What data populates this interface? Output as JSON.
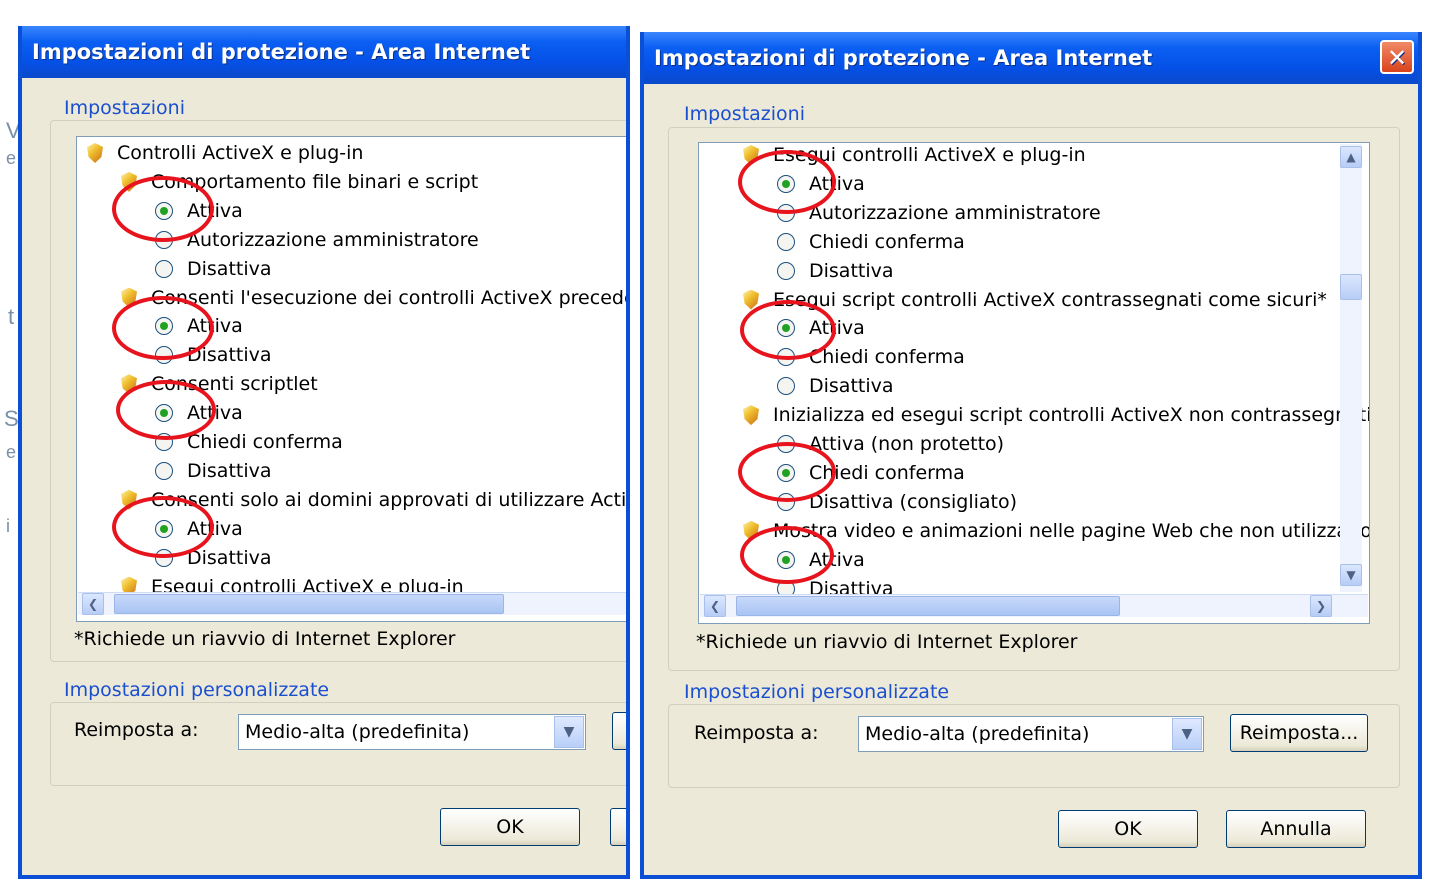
{
  "left_dialog": {
    "title": "Impostazioni di protezione - Area Internet",
    "settings_legend": "Impostazioni",
    "tree": [
      {
        "kind": "icon",
        "text": "Controlli ActiveX e plug-in"
      },
      {
        "kind": "icon",
        "text": "Comportamento file binari e script"
      },
      {
        "kind": "radio",
        "checked": true,
        "text": "Attiva"
      },
      {
        "kind": "radio",
        "checked": false,
        "text": "Autorizzazione amministratore"
      },
      {
        "kind": "radio",
        "checked": false,
        "text": "Disattiva"
      },
      {
        "kind": "icon",
        "text": "Consenti l'esecuzione dei controlli ActiveX precedentem"
      },
      {
        "kind": "radio",
        "checked": true,
        "text": "Attiva"
      },
      {
        "kind": "radio",
        "checked": false,
        "text": "Disattiva"
      },
      {
        "kind": "icon",
        "text": "Consenti scriptlet"
      },
      {
        "kind": "radio",
        "checked": true,
        "text": "Attiva"
      },
      {
        "kind": "radio",
        "checked": false,
        "text": "Chiedi conferma"
      },
      {
        "kind": "radio",
        "checked": false,
        "text": "Disattiva"
      },
      {
        "kind": "icon",
        "text": "Consenti solo ai domini approvati di utilizzare ActiveX se"
      },
      {
        "kind": "radio",
        "checked": true,
        "text": "Attiva"
      },
      {
        "kind": "radio",
        "checked": false,
        "text": "Disattiva"
      },
      {
        "kind": "icon",
        "text": "Esegui controlli ActiveX e plug-in"
      }
    ],
    "restart_note": "*Richiede un riavvio di Internet Explorer",
    "custom_legend": "Impostazioni personalizzate",
    "reset_label": "Reimposta a:",
    "reset_value": "Medio-alta (predefinita)",
    "reset_button": "R",
    "ok_button": "OK"
  },
  "right_dialog": {
    "title": "Impostazioni di protezione - Area Internet",
    "close_icon": "close-icon",
    "settings_legend": "Impostazioni",
    "tree": [
      {
        "kind": "icon",
        "text": "Esegui controlli ActiveX e plug-in"
      },
      {
        "kind": "radio",
        "checked": true,
        "text": "Attiva"
      },
      {
        "kind": "radio",
        "checked": false,
        "text": "Autorizzazione amministratore"
      },
      {
        "kind": "radio",
        "checked": false,
        "text": "Chiedi conferma"
      },
      {
        "kind": "radio",
        "checked": false,
        "text": "Disattiva"
      },
      {
        "kind": "icon",
        "text": "Esegui script controlli ActiveX contrassegnati come sicuri*"
      },
      {
        "kind": "radio",
        "checked": true,
        "text": "Attiva"
      },
      {
        "kind": "radio",
        "checked": false,
        "text": "Chiedi conferma"
      },
      {
        "kind": "radio",
        "checked": false,
        "text": "Disattiva"
      },
      {
        "kind": "icon",
        "text": "Inizializza ed esegui script controlli ActiveX non contrassegnati co"
      },
      {
        "kind": "radio",
        "checked": false,
        "text": "Attiva (non protetto)"
      },
      {
        "kind": "radio",
        "checked": true,
        "text": "Chiedi conferma"
      },
      {
        "kind": "radio",
        "checked": false,
        "text": "Disattiva (consigliato)"
      },
      {
        "kind": "icon",
        "text": "Mostra video e animazioni nelle pagine Web che non utilizzano un"
      },
      {
        "kind": "radio",
        "checked": true,
        "text": "Attiva"
      },
      {
        "kind": "radio",
        "checked": false,
        "text": "Disattiva"
      }
    ],
    "restart_note": "*Richiede un riavvio di Internet Explorer",
    "custom_legend": "Impostazioni personalizzate",
    "reset_label": "Reimposta a:",
    "reset_value": "Medio-alta (predefinita)",
    "reset_button": "Reimposta...",
    "ok_button": "OK",
    "cancel_button": "Annulla"
  },
  "background_fragments": [
    "V",
    "e",
    "t",
    "S",
    "e",
    "i",
    "V",
    "t",
    "S",
    "e",
    "i"
  ],
  "annotation_color": "#e8141d"
}
